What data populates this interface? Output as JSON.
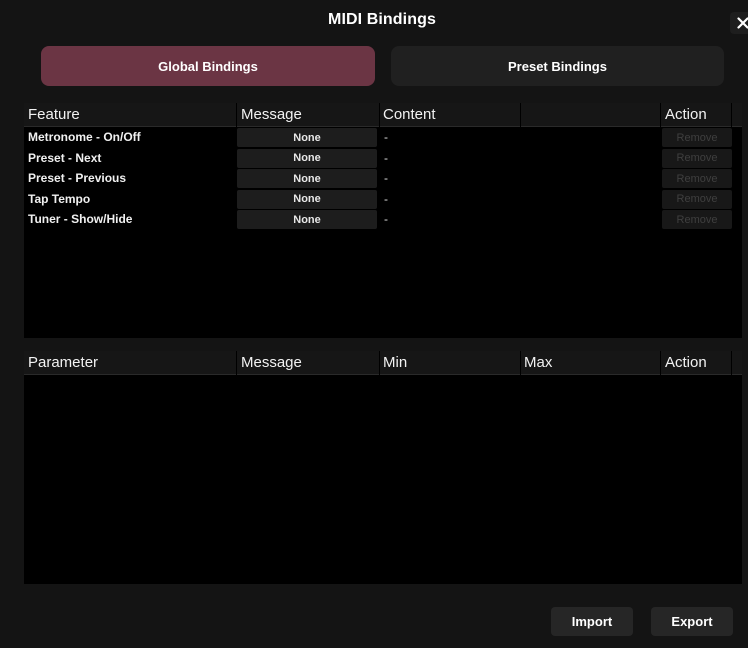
{
  "dialog": {
    "title": "MIDI Bindings"
  },
  "tabs": [
    {
      "label": "Global Bindings",
      "active": true
    },
    {
      "label": "Preset Bindings",
      "active": false
    }
  ],
  "features_table": {
    "columns": [
      "Feature",
      "Message",
      "Content",
      "Action"
    ],
    "rows": [
      {
        "feature": "Metronome - On/Off",
        "message": "None",
        "content": "-",
        "action": "Remove"
      },
      {
        "feature": "Preset - Next",
        "message": "None",
        "content": "-",
        "action": "Remove"
      },
      {
        "feature": "Preset - Previous",
        "message": "None",
        "content": "-",
        "action": "Remove"
      },
      {
        "feature": "Tap Tempo",
        "message": "None",
        "content": "-",
        "action": "Remove"
      },
      {
        "feature": "Tuner - Show/Hide",
        "message": "None",
        "content": "-",
        "action": "Remove"
      }
    ]
  },
  "params_table": {
    "columns": [
      "Parameter",
      "Message",
      "Min",
      "Max",
      "Action"
    ],
    "rows": []
  },
  "footer": {
    "import_label": "Import",
    "export_label": "Export"
  },
  "colors": {
    "active_tab": "#6b3544",
    "inactive_tab": "#202020",
    "background": "#141414",
    "table_bg": "#000000"
  }
}
